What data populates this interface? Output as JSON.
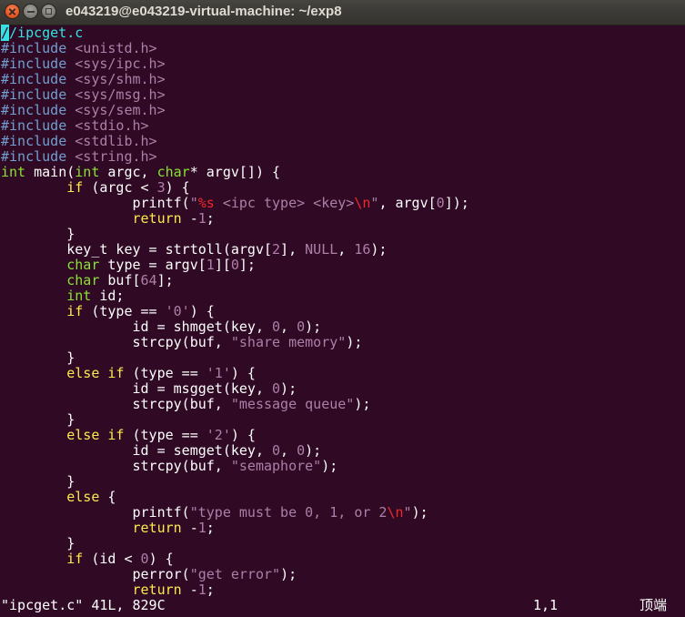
{
  "window": {
    "title": "e043219@e043219-virtual-machine: ~/exp8",
    "controls": {
      "close": "close-icon",
      "minimize": "minimize-icon",
      "maximize": "maximize-icon"
    }
  },
  "colors": {
    "titlebar": "#3c3b37",
    "title_text": "#dfdbd2",
    "close_button": "#e95420",
    "button": "#7d7c77",
    "terminal_bg": "#300a24",
    "foreground": "#ffffff"
  },
  "editor": {
    "lines": [
      [
        {
          "t": "/",
          "c": "#34e2e2",
          "cursor": true
        },
        {
          "t": "/ipcget.c",
          "c": "#34e2e2"
        }
      ],
      [
        {
          "t": "#include",
          "c": "#729fcf"
        },
        {
          "t": " <unistd.h>",
          "c": "#ad7fa8"
        }
      ],
      [
        {
          "t": "#include",
          "c": "#729fcf"
        },
        {
          "t": " <sys/ipc.h>",
          "c": "#ad7fa8"
        }
      ],
      [
        {
          "t": "#include",
          "c": "#729fcf"
        },
        {
          "t": " <sys/shm.h>",
          "c": "#ad7fa8"
        }
      ],
      [
        {
          "t": "#include",
          "c": "#729fcf"
        },
        {
          "t": " <sys/msg.h>",
          "c": "#ad7fa8"
        }
      ],
      [
        {
          "t": "#include",
          "c": "#729fcf"
        },
        {
          "t": " <sys/sem.h>",
          "c": "#ad7fa8"
        }
      ],
      [
        {
          "t": "#include",
          "c": "#729fcf"
        },
        {
          "t": " <stdio.h>",
          "c": "#ad7fa8"
        }
      ],
      [
        {
          "t": "#include",
          "c": "#729fcf"
        },
        {
          "t": " <stdlib.h>",
          "c": "#ad7fa8"
        }
      ],
      [
        {
          "t": "#include",
          "c": "#729fcf"
        },
        {
          "t": " <string.h>",
          "c": "#ad7fa8"
        }
      ],
      [
        {
          "t": "int",
          "c": "#8ae234"
        },
        {
          "t": " main("
        },
        {
          "t": "int",
          "c": "#8ae234"
        },
        {
          "t": " argc, "
        },
        {
          "t": "char",
          "c": "#8ae234"
        },
        {
          "t": "* argv[]) {"
        }
      ],
      [
        {
          "t": "        if",
          "c": "#fce94f"
        },
        {
          "t": " (argc < "
        },
        {
          "t": "3",
          "c": "#ad7fa8"
        },
        {
          "t": ") {"
        }
      ],
      [
        {
          "t": "                printf("
        },
        {
          "t": "\"",
          "c": "#ad7fa8"
        },
        {
          "t": "%s",
          "c": "#ef2929"
        },
        {
          "t": " <ipc type> <key>",
          "c": "#ad7fa8"
        },
        {
          "t": "\\n",
          "c": "#ef2929"
        },
        {
          "t": "\"",
          "c": "#ad7fa8"
        },
        {
          "t": ", argv["
        },
        {
          "t": "0",
          "c": "#ad7fa8"
        },
        {
          "t": "]);"
        }
      ],
      [
        {
          "t": "                return",
          "c": "#fce94f"
        },
        {
          "t": " -"
        },
        {
          "t": "1",
          "c": "#ad7fa8"
        },
        {
          "t": ";"
        }
      ],
      [
        {
          "t": "        }"
        }
      ],
      [
        {
          "t": "        key_t key = strtoll(argv["
        },
        {
          "t": "2",
          "c": "#ad7fa8"
        },
        {
          "t": "], "
        },
        {
          "t": "NULL",
          "c": "#ad7fa8"
        },
        {
          "t": ", "
        },
        {
          "t": "16",
          "c": "#ad7fa8"
        },
        {
          "t": ");"
        }
      ],
      [
        {
          "t": "        char",
          "c": "#8ae234"
        },
        {
          "t": " type = argv["
        },
        {
          "t": "1",
          "c": "#ad7fa8"
        },
        {
          "t": "]["
        },
        {
          "t": "0",
          "c": "#ad7fa8"
        },
        {
          "t": "];"
        }
      ],
      [
        {
          "t": "        char",
          "c": "#8ae234"
        },
        {
          "t": " buf["
        },
        {
          "t": "64",
          "c": "#ad7fa8"
        },
        {
          "t": "];"
        }
      ],
      [
        {
          "t": "        int",
          "c": "#8ae234"
        },
        {
          "t": " id;"
        }
      ],
      [
        {
          "t": "        if",
          "c": "#fce94f"
        },
        {
          "t": " (type == "
        },
        {
          "t": "'0'",
          "c": "#ad7fa8"
        },
        {
          "t": ") {"
        }
      ],
      [
        {
          "t": "                id = shmget(key, "
        },
        {
          "t": "0",
          "c": "#ad7fa8"
        },
        {
          "t": ", "
        },
        {
          "t": "0",
          "c": "#ad7fa8"
        },
        {
          "t": ");"
        }
      ],
      [
        {
          "t": "                strcpy(buf, "
        },
        {
          "t": "\"share memory\"",
          "c": "#ad7fa8"
        },
        {
          "t": ");"
        }
      ],
      [
        {
          "t": "        }"
        }
      ],
      [
        {
          "t": "        else if",
          "c": "#fce94f"
        },
        {
          "t": " (type == "
        },
        {
          "t": "'1'",
          "c": "#ad7fa8"
        },
        {
          "t": ") {"
        }
      ],
      [
        {
          "t": "                id = msgget(key, "
        },
        {
          "t": "0",
          "c": "#ad7fa8"
        },
        {
          "t": ");"
        }
      ],
      [
        {
          "t": "                strcpy(buf, "
        },
        {
          "t": "\"message queue\"",
          "c": "#ad7fa8"
        },
        {
          "t": ");"
        }
      ],
      [
        {
          "t": "        }"
        }
      ],
      [
        {
          "t": "        else if",
          "c": "#fce94f"
        },
        {
          "t": " (type == "
        },
        {
          "t": "'2'",
          "c": "#ad7fa8"
        },
        {
          "t": ") {"
        }
      ],
      [
        {
          "t": "                id = semget(key, "
        },
        {
          "t": "0",
          "c": "#ad7fa8"
        },
        {
          "t": ", "
        },
        {
          "t": "0",
          "c": "#ad7fa8"
        },
        {
          "t": ");"
        }
      ],
      [
        {
          "t": "                strcpy(buf, "
        },
        {
          "t": "\"semaphore\"",
          "c": "#ad7fa8"
        },
        {
          "t": ");"
        }
      ],
      [
        {
          "t": "        }"
        }
      ],
      [
        {
          "t": "        else",
          "c": "#fce94f"
        },
        {
          "t": " {"
        }
      ],
      [
        {
          "t": "                printf("
        },
        {
          "t": "\"type must be 0, 1, or 2",
          "c": "#ad7fa8"
        },
        {
          "t": "\\n",
          "c": "#ef2929"
        },
        {
          "t": "\"",
          "c": "#ad7fa8"
        },
        {
          "t": ");"
        }
      ],
      [
        {
          "t": "                return",
          "c": "#fce94f"
        },
        {
          "t": " -"
        },
        {
          "t": "1",
          "c": "#ad7fa8"
        },
        {
          "t": ";"
        }
      ],
      [
        {
          "t": "        }"
        }
      ],
      [
        {
          "t": "        if",
          "c": "#fce94f"
        },
        {
          "t": " (id < "
        },
        {
          "t": "0",
          "c": "#ad7fa8"
        },
        {
          "t": ") {"
        }
      ],
      [
        {
          "t": "                perror("
        },
        {
          "t": "\"get error\"",
          "c": "#ad7fa8"
        },
        {
          "t": ");"
        }
      ],
      [
        {
          "t": "                return",
          "c": "#fce94f"
        },
        {
          "t": " -"
        },
        {
          "t": "1",
          "c": "#ad7fa8"
        },
        {
          "t": ";"
        }
      ]
    ]
  },
  "status": {
    "message": "\"ipcget.c\" 41L, 829C",
    "position": "1,1",
    "scroll": "顶端"
  }
}
